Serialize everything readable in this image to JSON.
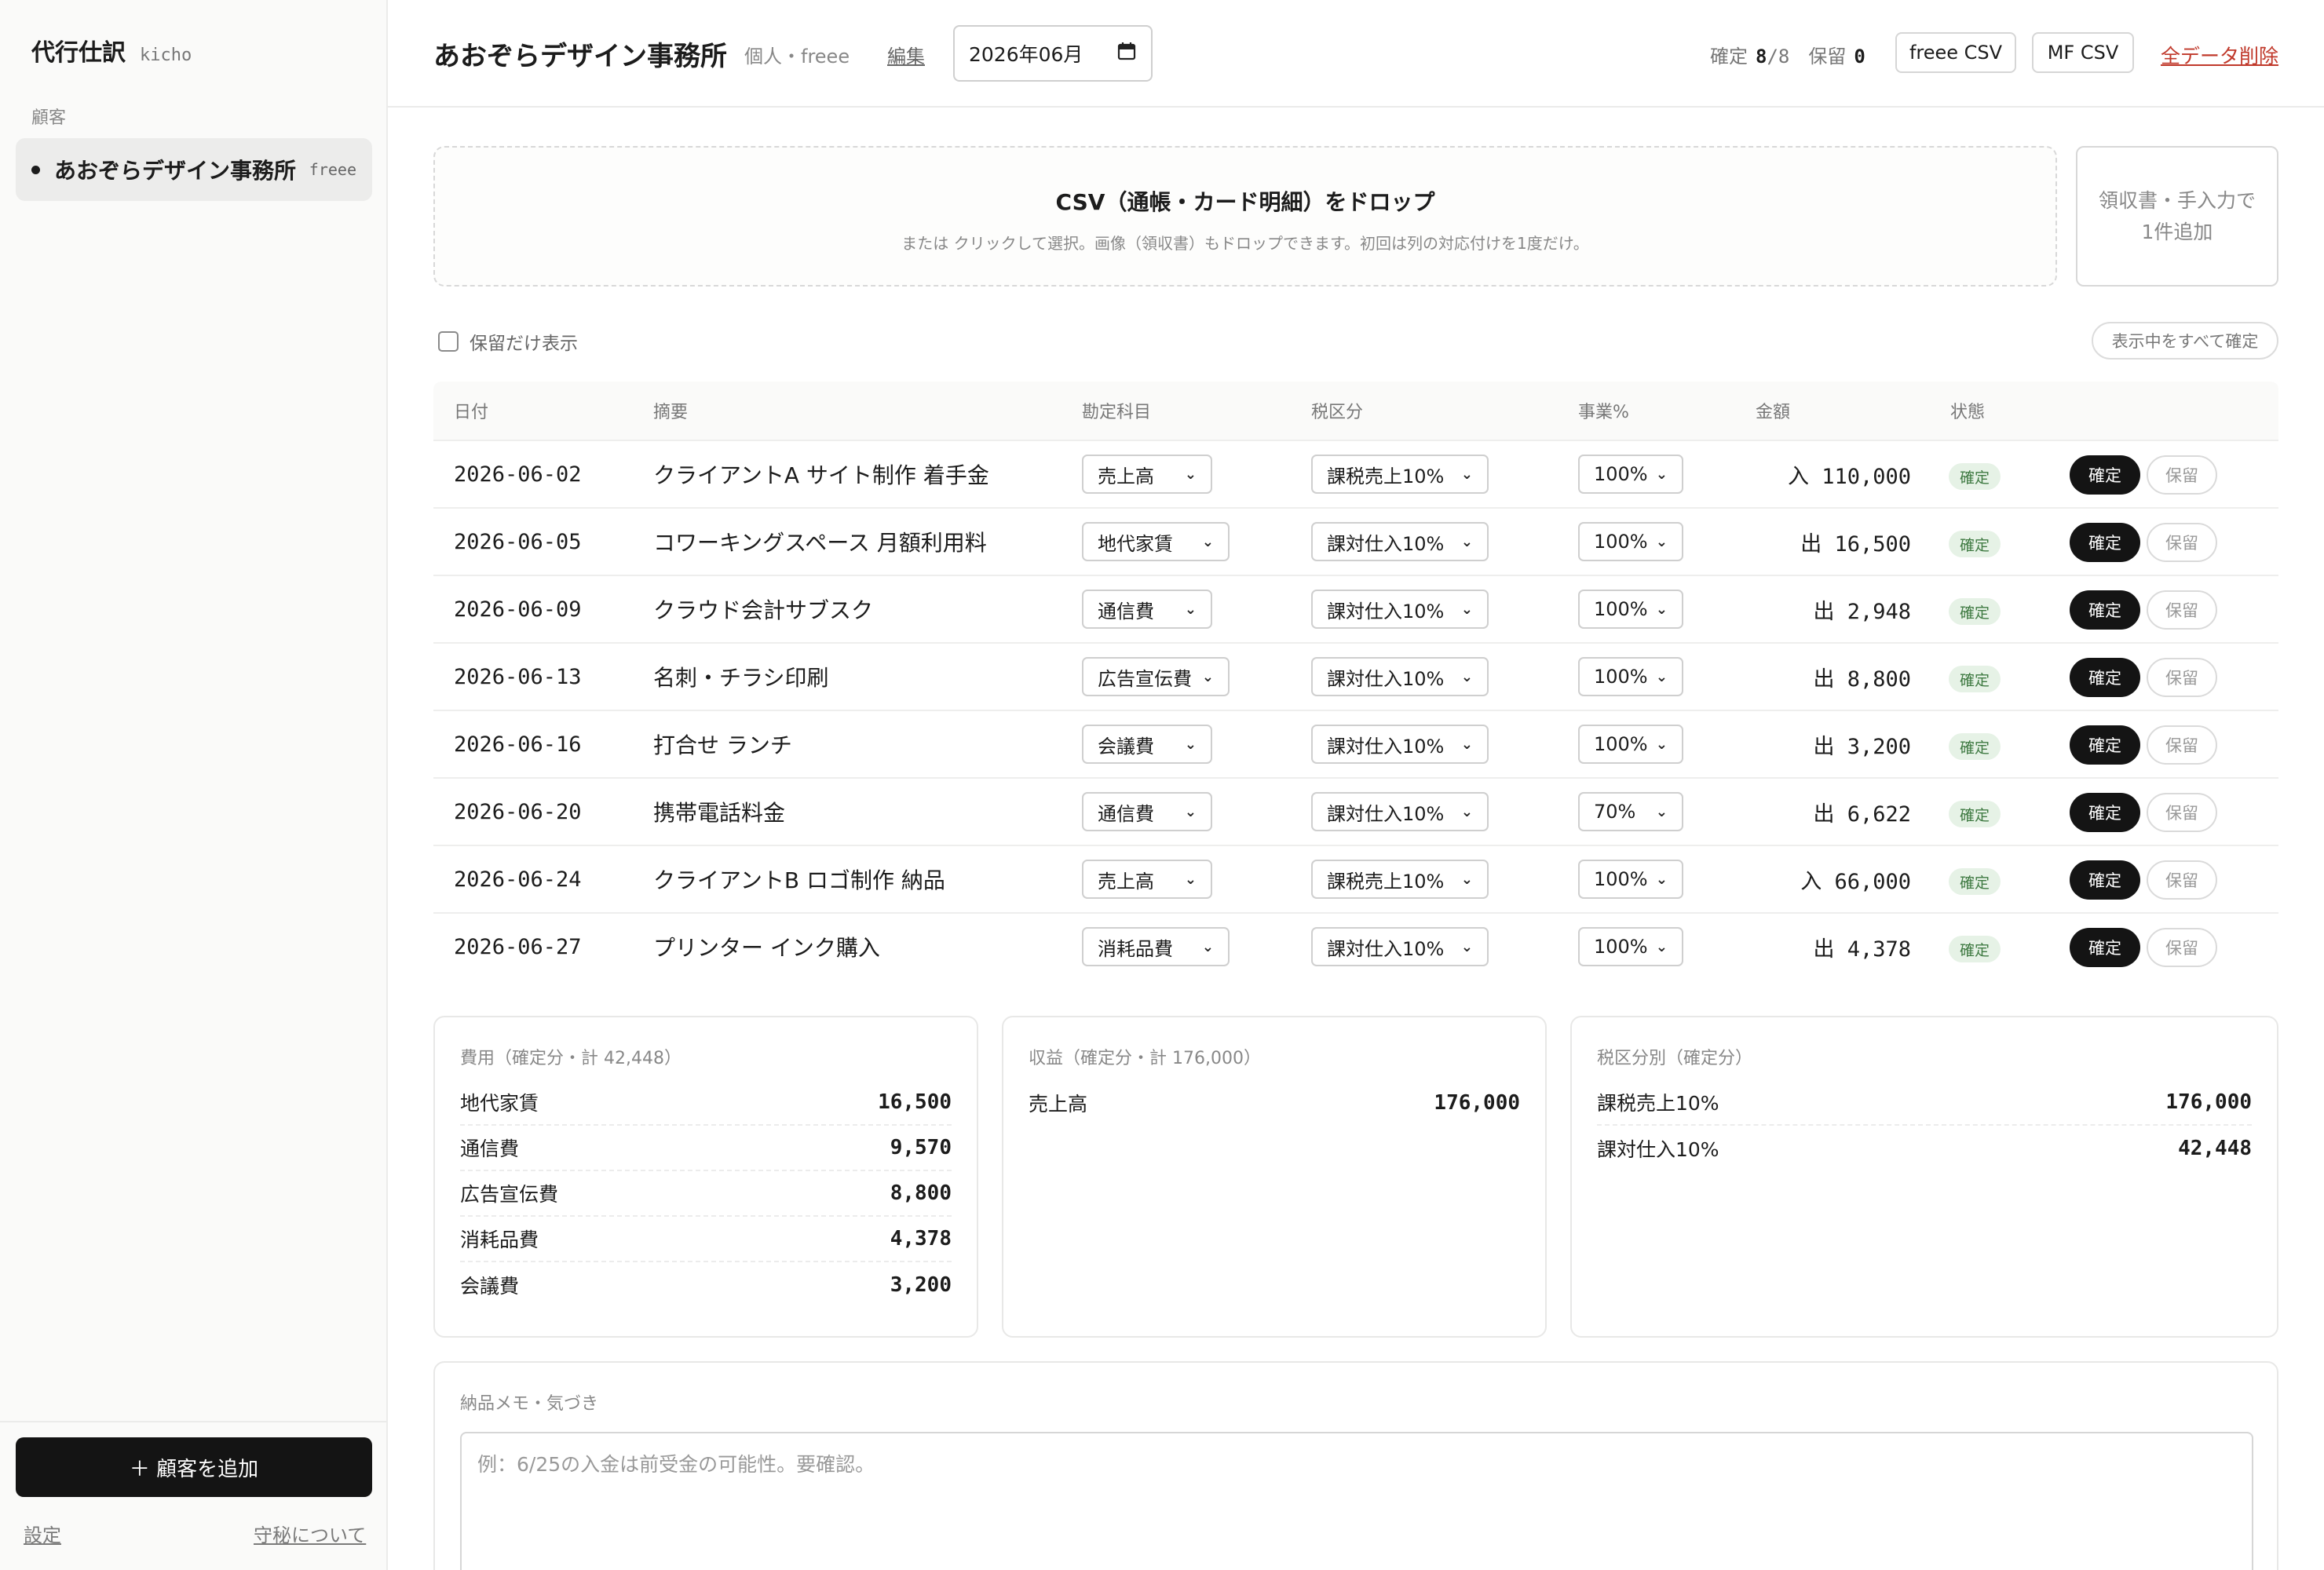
{
  "sidebar": {
    "brand_title": "代行仕訳",
    "brand_sub": "kicho",
    "section_label": "顧客",
    "client": {
      "name": "あおぞらデザイン事務所",
      "tag": "freee"
    },
    "add_client": "＋ 顧客を追加",
    "settings_link": "設定",
    "confidentiality_link": "守秘について"
  },
  "header": {
    "title": "あおぞらデザイン事務所",
    "subtitle": "個人・freee",
    "edit_link": "編集",
    "month_value": "2026年06月",
    "calendar_icon": "calendar-icon",
    "stats": {
      "confirmed_label": "確定",
      "confirmed_count": "8",
      "confirmed_total": "/8",
      "hold_label": "保留",
      "hold_count": "0"
    },
    "freee_csv": "freee CSV",
    "mf_csv": "MF CSV",
    "delete_all": "全データ削除"
  },
  "dropzone": {
    "title": "CSV（通帳・カード明細）をドロップ",
    "sub": "または クリックして選択。画像（領収書）もドロップできます。初回は列の対応付けを1度だけ。"
  },
  "receipt_box": {
    "line1": "領収書・手入力で",
    "line2": "1件追加"
  },
  "filter": {
    "hold_only_label": "保留だけ表示",
    "confirm_all": "表示中をすべて確定"
  },
  "table": {
    "headers": {
      "date": "日付",
      "desc": "摘要",
      "account": "勘定科目",
      "tax": "税区分",
      "biz": "事業%",
      "amount": "金額",
      "status": "状態"
    },
    "rows": [
      {
        "date": "2026-06-02",
        "desc": "クライアントA サイト制作 着手金",
        "account": "売上高",
        "tax": "課税売上10%",
        "biz": "100%",
        "amount": "入 110,000",
        "status": "確定",
        "confirm": "確定",
        "hold": "保留"
      },
      {
        "date": "2026-06-05",
        "desc": "コワーキングスペース 月額利用料",
        "account": "地代家賃",
        "tax": "課対仕入10%",
        "biz": "100%",
        "amount": "出 16,500",
        "status": "確定",
        "confirm": "確定",
        "hold": "保留"
      },
      {
        "date": "2026-06-09",
        "desc": "クラウド会計サブスク",
        "account": "通信費",
        "tax": "課対仕入10%",
        "biz": "100%",
        "amount": "出 2,948",
        "status": "確定",
        "confirm": "確定",
        "hold": "保留"
      },
      {
        "date": "2026-06-13",
        "desc": "名刺・チラシ印刷",
        "account": "広告宣伝費",
        "tax": "課対仕入10%",
        "biz": "100%",
        "amount": "出 8,800",
        "status": "確定",
        "confirm": "確定",
        "hold": "保留"
      },
      {
        "date": "2026-06-16",
        "desc": "打合せ ランチ",
        "account": "会議費",
        "tax": "課対仕入10%",
        "biz": "100%",
        "amount": "出 3,200",
        "status": "確定",
        "confirm": "確定",
        "hold": "保留"
      },
      {
        "date": "2026-06-20",
        "desc": "携帯電話料金",
        "account": "通信費",
        "tax": "課対仕入10%",
        "biz": "70%",
        "amount": "出 6,622",
        "status": "確定",
        "confirm": "確定",
        "hold": "保留"
      },
      {
        "date": "2026-06-24",
        "desc": "クライアントB ロゴ制作 納品",
        "account": "売上高",
        "tax": "課税売上10%",
        "biz": "100%",
        "amount": "入 66,000",
        "status": "確定",
        "confirm": "確定",
        "hold": "保留"
      },
      {
        "date": "2026-06-27",
        "desc": "プリンター インク購入",
        "account": "消耗品費",
        "tax": "課対仕入10%",
        "biz": "100%",
        "amount": "出 4,378",
        "status": "確定",
        "confirm": "確定",
        "hold": "保留"
      }
    ]
  },
  "summary": {
    "expenses": {
      "title": "費用（確定分・計 42,448）",
      "items": [
        {
          "label": "地代家賃",
          "value": "16,500"
        },
        {
          "label": "通信費",
          "value": "9,570"
        },
        {
          "label": "広告宣伝費",
          "value": "8,800"
        },
        {
          "label": "消耗品費",
          "value": "4,378"
        },
        {
          "label": "会議費",
          "value": "3,200"
        }
      ]
    },
    "revenue": {
      "title": "収益（確定分・計 176,000）",
      "items": [
        {
          "label": "売上高",
          "value": "176,000"
        }
      ]
    },
    "tax": {
      "title": "税区分別（確定分）",
      "items": [
        {
          "label": "課税売上10%",
          "value": "176,000"
        },
        {
          "label": "課対仕入10%",
          "value": "42,448"
        }
      ]
    }
  },
  "memo": {
    "title": "納品メモ・気づき",
    "placeholder": "例：6/25の入金は前受金の可能性。要確認。"
  },
  "colors": {
    "accent_dark": "#141414",
    "delete_red": "#c0392b",
    "badge_green": "#3f7a42"
  }
}
